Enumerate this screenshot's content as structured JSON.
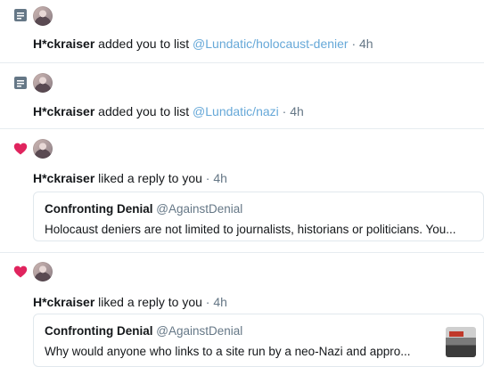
{
  "notifications": [
    {
      "type": "list",
      "icon": "list-icon",
      "user": "H*ckraiser",
      "action": " added you to list ",
      "list_link": "@Lundatic/holocaust-denier",
      "time": " · 4h"
    },
    {
      "type": "list",
      "icon": "list-icon",
      "user": "H*ckraiser",
      "action": " added you to list ",
      "list_link": "@Lundatic/nazi",
      "time": " · 4h"
    },
    {
      "type": "like",
      "icon": "heart-icon",
      "user": "H*ckraiser",
      "action": " liked a reply to you",
      "time": " · 4h",
      "tweet": {
        "name": "Confronting Denial",
        "handle": "@AgainstDenial",
        "text": "Holocaust deniers are not limited to journalists, historians or politicians. You..."
      }
    },
    {
      "type": "like",
      "icon": "heart-icon",
      "user": "H*ckraiser",
      "action": " liked a reply to you",
      "time": " · 4h",
      "tweet": {
        "name": "Confronting Denial",
        "handle": "@AgainstDenial",
        "text": "Why would anyone who links to a site run by a neo-Nazi and appro...",
        "has_thumbnail": true
      }
    }
  ],
  "colors": {
    "link": "#66a8d8",
    "heart": "#e0245e",
    "list_icon": "#657786",
    "muted": "#657786",
    "border": "#e1e8ed"
  }
}
